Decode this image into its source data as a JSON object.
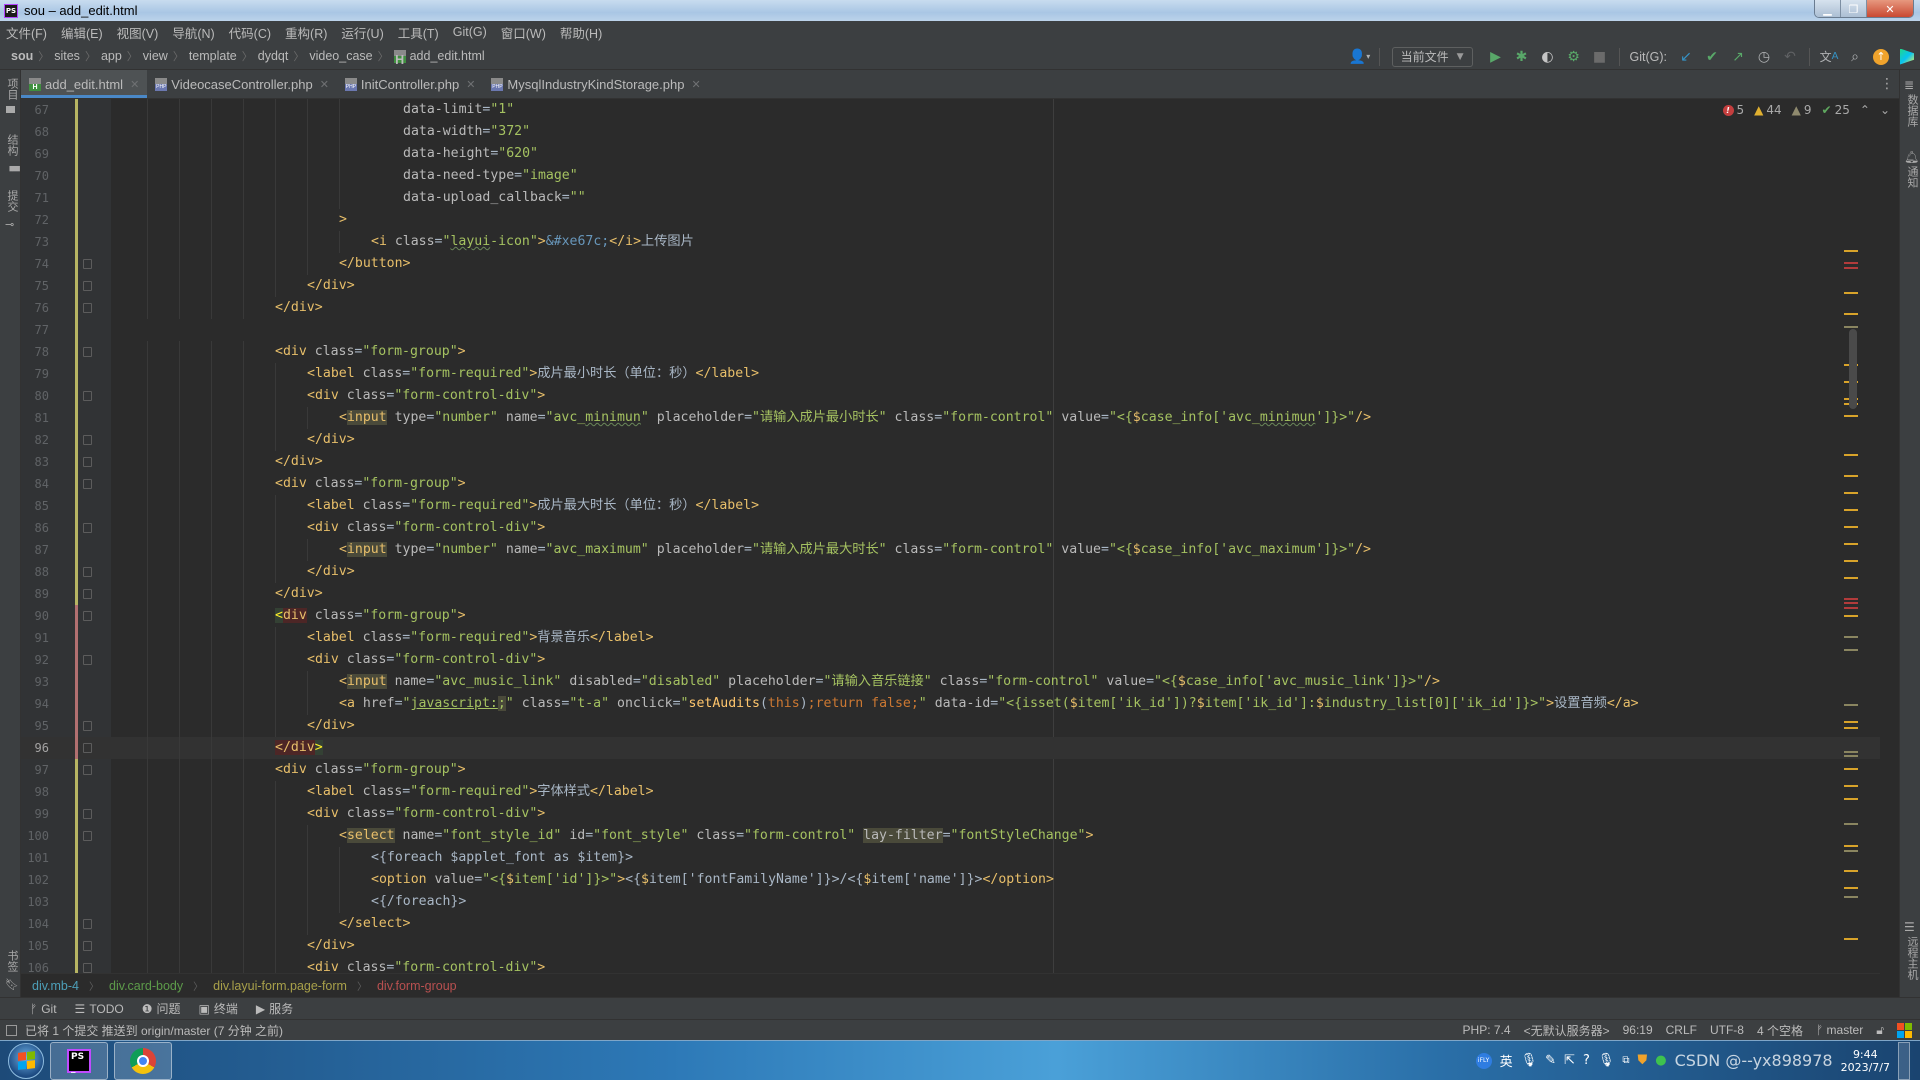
{
  "window": {
    "title": "sou – add_edit.html",
    "controls": [
      "minimize",
      "maximize",
      "close"
    ]
  },
  "menu": [
    "文件(F)",
    "编辑(E)",
    "视图(V)",
    "导航(N)",
    "代码(C)",
    "重构(R)",
    "运行(U)",
    "工具(T)",
    "Git(G)",
    "窗口(W)",
    "帮助(H)"
  ],
  "navbar": {
    "crumbs": [
      "sou",
      "sites",
      "app",
      "view",
      "template",
      "dydqt",
      "video_case",
      "add_edit.html"
    ],
    "run_config": "当前文件",
    "git_label": "Git(G):"
  },
  "tabs": [
    {
      "label": "add_edit.html",
      "type": "html",
      "active": true
    },
    {
      "label": "VideocaseController.php",
      "type": "php",
      "active": false
    },
    {
      "label": "InitController.php",
      "type": "php",
      "active": false
    },
    {
      "label": "MysqlIndustryKindStorage.php",
      "type": "php",
      "active": false
    }
  ],
  "left_stripe": {
    "top": [
      "项目",
      "结构",
      "提交"
    ],
    "bottom": [
      "书签"
    ]
  },
  "right_stripe": {
    "top": [
      "数据库",
      "通知"
    ],
    "bottom": [
      "远程主机"
    ]
  },
  "inspections": {
    "errors": "5",
    "warnings": "44",
    "weak_warnings": "9",
    "ok": "25"
  },
  "editor": {
    "current_line": 96,
    "lines": [
      {
        "n": "67",
        "html": "<span class='a'>data-limit</span><span class='p'>=</span><span class='s2'>\"1\"</span>",
        "indent": 9
      },
      {
        "n": "68",
        "html": "<span class='a'>data-width</span><span class='p'>=</span><span class='s2'>\"372\"</span>",
        "indent": 9
      },
      {
        "n": "69",
        "html": "<span class='a'>data-height</span><span class='p'>=</span><span class='s2'>\"620\"</span>",
        "indent": 9
      },
      {
        "n": "70",
        "html": "<span class='a'>data-need-type</span><span class='p'>=</span><span class='s2'>\"image\"</span>",
        "indent": 9
      },
      {
        "n": "71",
        "html": "<span class='a'>data-upload_callback</span><span class='p'>=</span><span class='s2'>\"\"</span>",
        "indent": 9
      },
      {
        "n": "72",
        "html": "<span class='t'>&gt;</span>",
        "indent": 7
      },
      {
        "n": "73",
        "html": "<span class='t'>&lt;i </span><span class='a'>class</span><span class='p'>=</span><span class='s2'>\"<span class='wav'>layui</span>-icon\"</span><span class='t'>&gt;</span><span class='e'>&amp;#xe67c;</span><span class='t'>&lt;/i&gt;</span><span class='p'>上传图片</span>",
        "indent": 8
      },
      {
        "n": "74",
        "html": "<span class='t'>&lt;/button&gt;</span>",
        "indent": 7,
        "fold": true
      },
      {
        "n": "75",
        "html": "<span class='t'>&lt;/div&gt;</span>",
        "indent": 6,
        "fold": true
      },
      {
        "n": "76",
        "html": "<span class='t'>&lt;/div&gt;</span>",
        "indent": 5,
        "fold": true
      },
      {
        "n": "77",
        "html": "",
        "indent": 0
      },
      {
        "n": "78",
        "html": "<span class='t'>&lt;div </span><span class='a'>class</span><span class='p'>=</span><span class='s2'>\"form-group\"</span><span class='t'>&gt;</span>",
        "indent": 5,
        "fold": true
      },
      {
        "n": "79",
        "html": "<span class='t'>&lt;label </span><span class='a'>class</span><span class='p'>=</span><span class='s2'>\"form-required\"</span><span class='t'>&gt;</span><span class='p'>成片最小时长（单位：秒）</span><span class='t'>&lt;/label&gt;</span>",
        "indent": 6
      },
      {
        "n": "80",
        "html": "<span class='t'>&lt;div </span><span class='a'>class</span><span class='p'>=</span><span class='s2'>\"form-control-div\"</span><span class='t'>&gt;</span>",
        "indent": 6,
        "fold": true
      },
      {
        "n": "81",
        "html": "<span class='t'>&lt;<span class='hl'>input</span> </span><span class='a'>type</span><span class='p'>=</span><span class='s2'>\"number\"</span> <span class='a'>name</span><span class='p'>=</span><span class='s2'>\"avc_<span class='wav'>minimun</span>\"</span> <span class='a'>placeholder</span><span class='p'>=</span><span class='s2'>\"请输入成片最小时长\"</span> <span class='a'>class</span><span class='p'>=</span><span class='s2'>\"form-control\"</span> <span class='a'>value</span><span class='p'>=</span><span class='s2'>\"&lt;{</span><span class='tv'>$</span><span class='s2'>case_info['avc_<span class='wav'>minimun</span>']}&gt;\"</span><span class='t'>/&gt;</span>",
        "indent": 7
      },
      {
        "n": "82",
        "html": "<span class='t'>&lt;/div&gt;</span>",
        "indent": 6,
        "fold": true
      },
      {
        "n": "83",
        "html": "<span class='t'>&lt;/div&gt;</span>",
        "indent": 5,
        "fold": true
      },
      {
        "n": "84",
        "html": "<span class='t'>&lt;div </span><span class='a'>class</span><span class='p'>=</span><span class='s2'>\"form-group\"</span><span class='t'>&gt;</span>",
        "indent": 5,
        "fold": true
      },
      {
        "n": "85",
        "html": "<span class='t'>&lt;label </span><span class='a'>class</span><span class='p'>=</span><span class='s2'>\"form-required\"</span><span class='t'>&gt;</span><span class='p'>成片最大时长（单位：秒）</span><span class='t'>&lt;/label&gt;</span>",
        "indent": 6
      },
      {
        "n": "86",
        "html": "<span class='t'>&lt;div </span><span class='a'>class</span><span class='p'>=</span><span class='s2'>\"form-control-div\"</span><span class='t'>&gt;</span>",
        "indent": 6,
        "fold": true
      },
      {
        "n": "87",
        "html": "<span class='t'>&lt;<span class='hl'>input</span> </span><span class='a'>type</span><span class='p'>=</span><span class='s2'>\"number\"</span> <span class='a'>name</span><span class='p'>=</span><span class='s2'>\"avc_maximum\"</span> <span class='a'>placeholder</span><span class='p'>=</span><span class='s2'>\"请输入成片最大时长\"</span> <span class='a'>class</span><span class='p'>=</span><span class='s2'>\"form-control\"</span> <span class='a'>value</span><span class='p'>=</span><span class='s2'>\"&lt;{</span><span class='tv'>$</span><span class='s2'>case_info['avc_maximum']}&gt;\"</span><span class='t'>/&gt;</span>",
        "indent": 7
      },
      {
        "n": "88",
        "html": "<span class='t'>&lt;/div&gt;</span>",
        "indent": 6,
        "fold": true
      },
      {
        "n": "89",
        "html": "<span class='t'>&lt;/div&gt;</span>",
        "indent": 5,
        "fold": true
      },
      {
        "n": "90",
        "html": "<span class='t'><span class='gr' style='color:#ffef28'>&lt;</span><span class='mhl'>div</span> </span><span class='a'>class</span><span class='p'>=</span><span class='s2'>\"form-group\"</span><span class='t'>&gt;</span>",
        "indent": 5,
        "fold": true,
        "mod": true
      },
      {
        "n": "91",
        "html": "<span class='t'>&lt;label </span><span class='a'>class</span><span class='p'>=</span><span class='s2'>\"form-required\"</span><span class='t'>&gt;</span><span class='p'>背景音乐</span><span class='t'>&lt;/label&gt;</span>",
        "indent": 6,
        "mod": true
      },
      {
        "n": "92",
        "html": "<span class='t'>&lt;div </span><span class='a'>class</span><span class='p'>=</span><span class='s2'>\"form-control-div\"</span><span class='t'>&gt;</span>",
        "indent": 6,
        "fold": true,
        "mod": true
      },
      {
        "n": "93",
        "html": "<span class='t'>&lt;<span class='hl'>input</span> </span><span class='a'>name</span><span class='p'>=</span><span class='s2'>\"avc_music_link\"</span> <span class='a'>disabled</span><span class='p'>=</span><span class='s2'>\"disabled\"</span> <span class='a'>placeholder</span><span class='p'>=</span><span class='s2'>\"请输入音乐链接\"</span> <span class='a'>class</span><span class='p'>=</span><span class='s2'>\"form-control\"</span> <span class='a'>value</span><span class='p'>=</span><span class='s2'>\"&lt;{</span><span class='tv'>$</span><span class='s2'>case_info['avc_music_link']}&gt;\"</span><span class='t'>/&gt;</span>",
        "indent": 7,
        "mod": true
      },
      {
        "n": "94",
        "html": "<span class='t'>&lt;a </span><span class='a'>href</span><span class='p'>=</span><span class='s2'>\"<span style='text-decoration:underline'>javascript:</span><span class='hl'>;</span>\"</span> <span class='a'>class</span><span class='p'>=</span><span class='s2'>\"t-a\"</span> <span class='a'>onclick</span><span class='p'>=</span><span class='s2'>\"</span><span class='fn'>setAudits</span><span class='p'>(</span><span class='k'>this</span><span class='p'>)</span><span class='k'>;return false;</span><span class='s2'>\"</span> <span class='a'>data-id</span><span class='p'>=</span><span class='s2'>\"&lt;{isset(</span><span class='tv'>$</span><span class='s2'>item['ik_id'])?</span><span class='tv'>$</span><span class='s2'>item['ik_id']:</span><span class='tv'>$</span><span class='s2'>industry_list[0]['ik_id']}&gt;\"</span><span class='t'>&gt;</span><span class='p'>设置音频</span><span class='t'>&lt;/a&gt;</span>",
        "indent": 7,
        "mod": true
      },
      {
        "n": "95",
        "html": "<span class='t'>&lt;/div&gt;</span>",
        "indent": 6,
        "fold": true,
        "mod": true
      },
      {
        "n": "96",
        "html": "<span class='t'><span class='mhl'>&lt;/div</span><span class='gr' style='color:#ffef28'>&gt;</span></span>",
        "indent": 5,
        "fold": true,
        "mod": true
      },
      {
        "n": "97",
        "html": "<span class='t'>&lt;div </span><span class='a'>class</span><span class='p'>=</span><span class='s2'>\"form-group\"</span><span class='t'>&gt;</span>",
        "indent": 5,
        "fold": true
      },
      {
        "n": "98",
        "html": "<span class='t'>&lt;label </span><span class='a'>class</span><span class='p'>=</span><span class='s2'>\"form-required\"</span><span class='t'>&gt;</span><span class='p'>字体样式</span><span class='t'>&lt;/label&gt;</span>",
        "indent": 6
      },
      {
        "n": "99",
        "html": "<span class='t'>&lt;div </span><span class='a'>class</span><span class='p'>=</span><span class='s2'>\"form-control-div\"</span><span class='t'>&gt;</span>",
        "indent": 6,
        "fold": true
      },
      {
        "n": "100",
        "html": "<span class='t'>&lt;<span class='hl'>select</span> </span><span class='a'>name</span><span class='p'>=</span><span class='s2'>\"font_style_id\"</span> <span class='a'>id</span><span class='p'>=</span><span class='s2'>\"font_style\"</span> <span class='a'>class</span><span class='p'>=</span><span class='s2'>\"form-control\"</span> <span class='a hl'>lay-filter</span><span class='p'>=</span><span class='s2'>\"fontStyleChange\"</span><span class='t'>&gt;</span>",
        "indent": 7,
        "fold": true
      },
      {
        "n": "101",
        "html": "<span class='p'>&lt;{foreach $applet_font as $item}&gt;</span>",
        "indent": 8
      },
      {
        "n": "102",
        "html": "<span class='t'>&lt;option </span><span class='a'>value</span><span class='p'>=</span><span class='s2'>\"&lt;{</span><span class='tv'>$</span><span class='s2'>item['id']}&gt;\"</span><span class='t'>&gt;</span><span class='p'>&lt;{</span><span class='tv'>$</span><span class='p'>item['fontFamilyName']}&gt;/&lt;{</span><span class='tv'>$</span><span class='p'>item['name']}&gt;</span><span class='t'>&lt;/option&gt;</span>",
        "indent": 8
      },
      {
        "n": "103",
        "html": "<span class='p'>&lt;{/foreach}&gt;</span>",
        "indent": 8
      },
      {
        "n": "104",
        "html": "<span class='t'>&lt;/select&gt;</span>",
        "indent": 7,
        "fold": true
      },
      {
        "n": "105",
        "html": "<span class='t'>&lt;/div&gt;</span>",
        "indent": 6,
        "fold": true
      },
      {
        "n": "106",
        "html": "<span class='t'>&lt;div </span><span class='a'>class</span><span class='p'>=</span><span class='s2'>\"form-control-div\"</span><span class='t'>&gt;</span>",
        "indent": 6,
        "fold": true
      }
    ]
  },
  "breadcrumb": [
    {
      "label": "div.mb-4",
      "color": "#4d9fb8"
    },
    {
      "label": "div.card-body",
      "color": "#5d9b4a"
    },
    {
      "label": "div.layui-form.page-form",
      "color": "#a8a04a"
    },
    {
      "label": "div.form-group",
      "color": "#b85050"
    }
  ],
  "tool_windows": [
    {
      "icon": "git-branch-icon",
      "glyph": "ᚠ",
      "label": "Git"
    },
    {
      "icon": "todo-list-icon",
      "glyph": "☰",
      "label": "TODO"
    },
    {
      "icon": "problems-icon",
      "glyph": "❶",
      "label": "问题"
    },
    {
      "icon": "terminal-icon",
      "glyph": "▣",
      "label": "终端"
    },
    {
      "icon": "services-icon",
      "glyph": "▶",
      "label": "服务"
    }
  ],
  "status": {
    "message": "已将 1 个提交 推送到 origin/master (7 分钟 之前)",
    "php_version": "PHP: 7.4",
    "server": "<无默认服务器>",
    "caret": "96:19",
    "line_ending": "CRLF",
    "encoding": "UTF-8",
    "indent": "4 个空格",
    "branch": "master"
  },
  "taskbar": {
    "apps": [
      "PhpStorm",
      "Chrome"
    ],
    "tray_text": "英",
    "time": "9:44",
    "date": "2023/7/7",
    "watermark": "CSDN @--yx898978"
  },
  "scroll_markers": [
    {
      "pos": 0.03,
      "color": "#d8a32a"
    },
    {
      "pos": 0.045,
      "color": "#b23b3b"
    },
    {
      "pos": 0.05,
      "color": "#b23b3b"
    },
    {
      "pos": 0.08,
      "color": "#d8a32a"
    },
    {
      "pos": 0.105,
      "color": "#d8a32a"
    },
    {
      "pos": 0.12,
      "color": "#8a8560"
    },
    {
      "pos": 0.165,
      "color": "#d8a32a"
    },
    {
      "pos": 0.185,
      "color": "#d8a32a"
    },
    {
      "pos": 0.205,
      "color": "#d8a32a"
    },
    {
      "pos": 0.21,
      "color": "#d8a32a"
    },
    {
      "pos": 0.225,
      "color": "#d8a32a"
    },
    {
      "pos": 0.27,
      "color": "#d8a32a"
    },
    {
      "pos": 0.295,
      "color": "#d8a32a"
    },
    {
      "pos": 0.315,
      "color": "#d8a32a"
    },
    {
      "pos": 0.335,
      "color": "#d8a32a"
    },
    {
      "pos": 0.355,
      "color": "#d8a32a"
    },
    {
      "pos": 0.375,
      "color": "#d8a32a"
    },
    {
      "pos": 0.395,
      "color": "#d8a32a"
    },
    {
      "pos": 0.415,
      "color": "#d8a32a"
    },
    {
      "pos": 0.44,
      "color": "#b23b3b"
    },
    {
      "pos": 0.445,
      "color": "#b23b3b"
    },
    {
      "pos": 0.45,
      "color": "#b23b3b"
    },
    {
      "pos": 0.46,
      "color": "#d8a32a"
    },
    {
      "pos": 0.485,
      "color": "#8a8560"
    },
    {
      "pos": 0.5,
      "color": "#8a8560"
    },
    {
      "pos": 0.565,
      "color": "#8a8560"
    },
    {
      "pos": 0.585,
      "color": "#d8a32a"
    },
    {
      "pos": 0.592,
      "color": "#d8a32a"
    },
    {
      "pos": 0.62,
      "color": "#8a8560"
    },
    {
      "pos": 0.625,
      "color": "#8a8560"
    },
    {
      "pos": 0.64,
      "color": "#d8a32a"
    },
    {
      "pos": 0.66,
      "color": "#d8a32a"
    },
    {
      "pos": 0.675,
      "color": "#d8a32a"
    },
    {
      "pos": 0.705,
      "color": "#8a8560"
    },
    {
      "pos": 0.73,
      "color": "#d8a32a"
    },
    {
      "pos": 0.737,
      "color": "#8a8560"
    },
    {
      "pos": 0.76,
      "color": "#d8a32a"
    },
    {
      "pos": 0.78,
      "color": "#d8a32a"
    },
    {
      "pos": 0.79,
      "color": "#8a8560"
    },
    {
      "pos": 0.84,
      "color": "#d8a32a"
    }
  ]
}
